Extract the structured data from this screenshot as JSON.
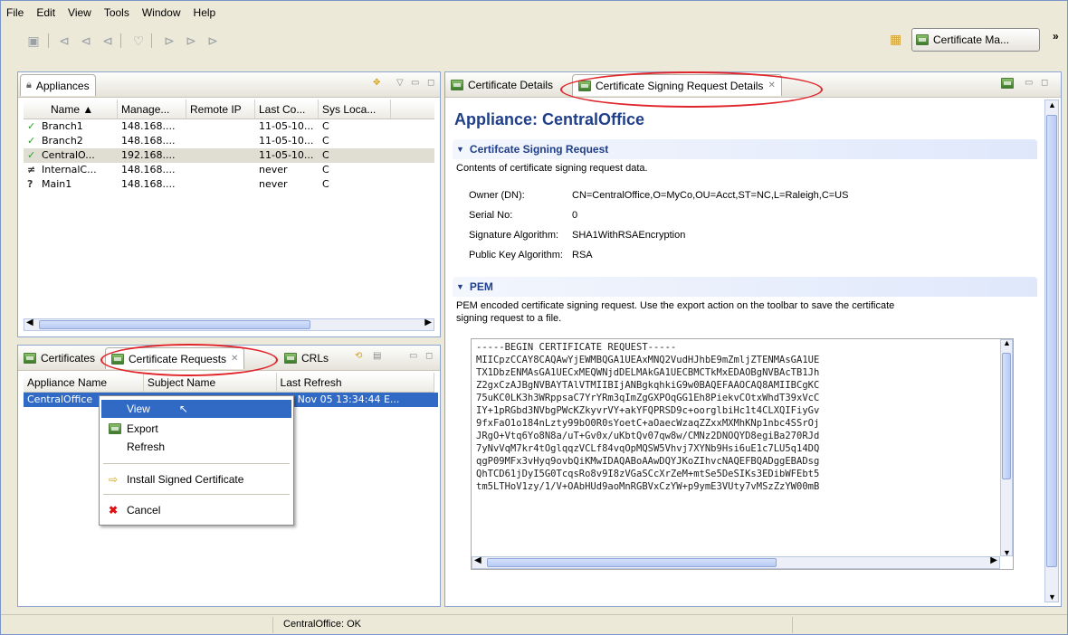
{
  "menubar": [
    "File",
    "Edit",
    "View",
    "Tools",
    "Window",
    "Help"
  ],
  "toolbar": {
    "perspective_label": "Certificate Ma...",
    "overflow": "»"
  },
  "appliances": {
    "tab_label": "Appliances",
    "columns": [
      "Name",
      "Manage...",
      "Remote IP",
      "Last Co...",
      "Sys Loca..."
    ],
    "rows": [
      {
        "status": "✓",
        "name": "Branch1",
        "mgmt": "148.168....",
        "remote": "",
        "last": "11-05-10...",
        "sys": "C"
      },
      {
        "status": "✓",
        "name": "Branch2",
        "mgmt": "148.168....",
        "remote": "",
        "last": "11-05-10...",
        "sys": "C"
      },
      {
        "status": "✓",
        "name": "CentralO...",
        "mgmt": "192.168....",
        "remote": "",
        "last": "11-05-10...",
        "sys": "C"
      },
      {
        "status": "≠",
        "name": "InternalC...",
        "mgmt": "148.168....",
        "remote": "",
        "last": "never",
        "sys": "C"
      },
      {
        "status": "?",
        "name": "Main1",
        "mgmt": "148.168....",
        "remote": "",
        "last": "never",
        "sys": "C"
      }
    ]
  },
  "bottom_tabs": {
    "certificates": "Certificates",
    "requests": "Certificate Requests",
    "crls": "CRLs",
    "columns": [
      "Appliance Name",
      "Subject Name",
      "Last Refresh"
    ],
    "row": {
      "appliance": "CentralOffice",
      "subject": "",
      "refresh": "Fri Nov 05 13:34:44 E..."
    }
  },
  "context_menu": {
    "view": "View",
    "export": "Export",
    "refresh": "Refresh",
    "install": "Install Signed Certificate",
    "cancel": "Cancel"
  },
  "right_tabs": {
    "cert_details": "Certificate Details",
    "csr_details": "Certificate Signing Request Details"
  },
  "detail": {
    "heading": "Appliance: CentralOffice",
    "csr_section": "Certifcate Signing Request",
    "csr_desc": "Contents of certificate signing request data.",
    "fields": [
      {
        "key": "Owner (DN):",
        "value": "CN=CentralOffice,O=MyCo,OU=Acct,ST=NC,L=Raleigh,C=US"
      },
      {
        "key": "Serial No:",
        "value": "0"
      },
      {
        "key": "Signature Algorithm:",
        "value": "SHA1WithRSAEncryption"
      },
      {
        "key": "Public Key Algorithm:",
        "value": "RSA"
      }
    ],
    "pem_section": "PEM",
    "pem_desc_1": "PEM encoded certificate signing request.  Use the export action on the toolbar to save the certificate",
    "pem_desc_2": "signing request to a file.",
    "pem_lines": [
      "-----BEGIN CERTIFICATE REQUEST-----",
      "MIICpzCCAY8CAQAwYjEWMBQGA1UEAxMNQ2VudHJhbE9mZmljZTENMAsGA1UE",
      "TX1DbzENMAsGA1UECxMEQWNjdDELMAkGA1UECBMCTkMxEDAOBgNVBAcTB1Jh",
      "Z2gxCzAJBgNVBAYTAlVTMIIBIjANBgkqhkiG9w0BAQEFAAOCAQ8AMIIBCgKC",
      "75uKC0LK3h3WRppsaC7YrYRm3qImZgGXPOqGG1Eh8PiekvCOtxWhdT39xVcC",
      "IY+1pRGbd3NVbgPWcKZkyvrVY+akYFQPRSD9c+oorglbiHc1t4CLXQIFiyGv",
      "9fxFaO1o184nLzty99bO0R0sYoetC+aOaecWzaqZZxxMXMhKNp1nbc4SSrOj",
      "JRgO+Vtq6Yo8N8a/uT+Gv0x/uKbtQv07qw8w/CMNz2DNOQYD8egiBa270RJd",
      "7yNvVqM7kr4tOglqqzVCLf84vqOpMQSW5Vhvj7XYNb9Hsi6uE1c7LU5q14DQ",
      "qgP09MFx3vHyq9ovbQiKMwIDAQABoAAwDQYJKoZIhvcNAQEFBQADggEBADsg",
      "QhTCD61jDyI5G0TcqsRo8v9I8zVGaSCcXrZeM+mtSe5DeSIKs3EDibWFEbt5",
      "tm5LTHoV1zy/1/V+OAbHUd9aoMnRGBVxCzYW+p9ymE3VUty7vMSzZzYW00mB"
    ]
  },
  "status": {
    "message": "CentralOffice: OK"
  }
}
